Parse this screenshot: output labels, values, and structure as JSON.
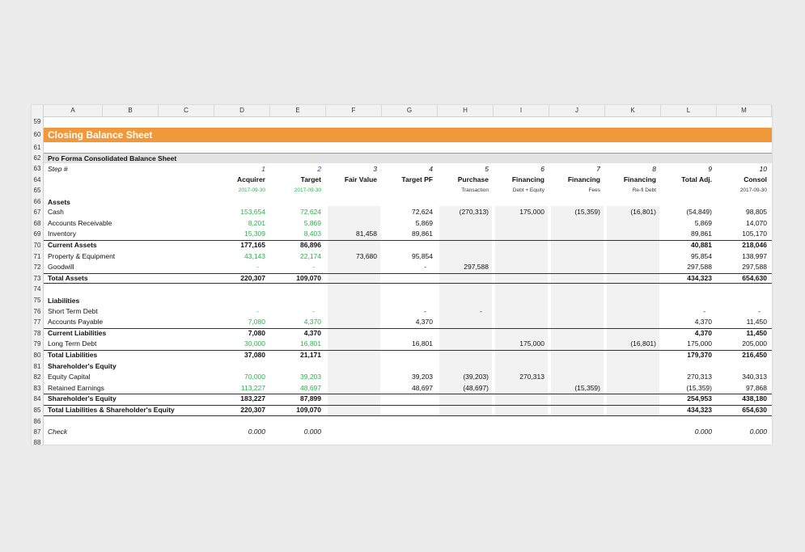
{
  "columns": [
    "A",
    "B",
    "C",
    "D",
    "E",
    "F",
    "G",
    "H",
    "I",
    "J",
    "K",
    "L",
    "M"
  ],
  "row_numbers": [
    "59",
    "60",
    "61",
    "62",
    "63",
    "64",
    "65",
    "66",
    "67",
    "68",
    "69",
    "70",
    "71",
    "72",
    "73",
    "74",
    "75",
    "76",
    "77",
    "78",
    "79",
    "80",
    "81",
    "82",
    "83",
    "84",
    "85",
    "86",
    "87",
    "88"
  ],
  "title": "Closing Balance Sheet",
  "subtitle": "Pro Forma Consolidated Balance Sheet",
  "step_label": "Step #",
  "steps": [
    "1",
    "2",
    "3",
    "4",
    "5",
    "6",
    "7",
    "8",
    "9",
    "10"
  ],
  "headers": [
    "Acquirer",
    "Target",
    "Fair Value",
    "Target PF",
    "Purchase",
    "Financing",
    "Financing",
    "Financing",
    "Total Adj.",
    "Consol"
  ],
  "subheaders": [
    "2017-09-30",
    "2017-09-30",
    "",
    "",
    "Transaction",
    "Debt + Equity",
    "Fees",
    "Re-fi Debt",
    "",
    "2017-09-30"
  ],
  "sections": {
    "assets": "Assets",
    "liabilities": "Liabilities",
    "equity": "Shareholder's Equity"
  },
  "rows": [
    {
      "label": "Cash",
      "v": [
        "153,654",
        "72,624",
        "",
        "72,624",
        "(270,313)",
        "175,000",
        "(15,359)",
        "(16,801)",
        "(54,849)",
        "98,805"
      ]
    },
    {
      "label": "Accounts Receivable",
      "v": [
        "8,201",
        "5,869",
        "",
        "5,869",
        "",
        "",
        "",
        "",
        "5,869",
        "14,070"
      ]
    },
    {
      "label": "Inventory",
      "v": [
        "15,309",
        "8,403",
        "81,458",
        "89,861",
        "",
        "",
        "",
        "",
        "89,861",
        "105,170"
      ]
    },
    {
      "label": "Current Assets",
      "v": [
        "177,165",
        "86,896",
        "",
        "",
        "",
        "",
        "",
        "",
        "40,881",
        "218,046"
      ]
    },
    {
      "label": "Property & Equipment",
      "v": [
        "43,143",
        "22,174",
        "73,680",
        "95,854",
        "",
        "",
        "",
        "",
        "95,854",
        "138,997"
      ]
    },
    {
      "label": "Goodwill",
      "v": [
        "-",
        "-",
        "",
        "-",
        "297,588",
        "",
        "",
        "",
        "297,588",
        "297,588"
      ]
    },
    {
      "label": "Total Assets",
      "v": [
        "220,307",
        "109,070",
        "",
        "",
        "",
        "",
        "",
        "",
        "434,323",
        "654,630"
      ]
    },
    {
      "label": "Short Term Debt",
      "v": [
        "-",
        "-",
        "",
        "-",
        "-",
        "",
        "",
        "",
        "-",
        "-"
      ]
    },
    {
      "label": "Accounts Payable",
      "v": [
        "7,080",
        "4,370",
        "",
        "4,370",
        "",
        "",
        "",
        "",
        "4,370",
        "11,450"
      ]
    },
    {
      "label": "Current Liabilities",
      "v": [
        "7,080",
        "4,370",
        "",
        "",
        "",
        "",
        "",
        "",
        "4,370",
        "11,450"
      ]
    },
    {
      "label": "Long Term Debt",
      "v": [
        "30,000",
        "16,801",
        "",
        "16,801",
        "",
        "175,000",
        "",
        "(16,801)",
        "175,000",
        "205,000"
      ]
    },
    {
      "label": "Total Liabilities",
      "v": [
        "37,080",
        "21,171",
        "",
        "",
        "",
        "",
        "",
        "",
        "179,370",
        "216,450"
      ]
    },
    {
      "label": "Equity Capital",
      "v": [
        "70,000",
        "39,203",
        "",
        "39,203",
        "(39,203)",
        "270,313",
        "",
        "",
        "270,313",
        "340,313"
      ]
    },
    {
      "label": "Retained Earnings",
      "v": [
        "113,227",
        "48,697",
        "",
        "48,697",
        "(48,697)",
        "",
        "(15,359)",
        "",
        "(15,359)",
        "97,868"
      ]
    },
    {
      "label": "Shareholder's Equity",
      "v": [
        "183,227",
        "87,899",
        "",
        "",
        "",
        "",
        "",
        "",
        "254,953",
        "438,180"
      ]
    },
    {
      "label": "Total Liabilities & Shareholder's Equity",
      "v": [
        "220,307",
        "109,070",
        "",
        "",
        "",
        "",
        "",
        "",
        "434,323",
        "654,630"
      ]
    }
  ],
  "check": {
    "label": "Check",
    "v": [
      "0.000",
      "0.000",
      "",
      "",
      "",
      "",
      "",
      "",
      "0.000",
      "0.000"
    ]
  },
  "colors": {
    "banner": "#f0983a",
    "input_green": "#2bb34b",
    "step_blue": "#1f3fd0",
    "shade": "#f2f2f2"
  }
}
